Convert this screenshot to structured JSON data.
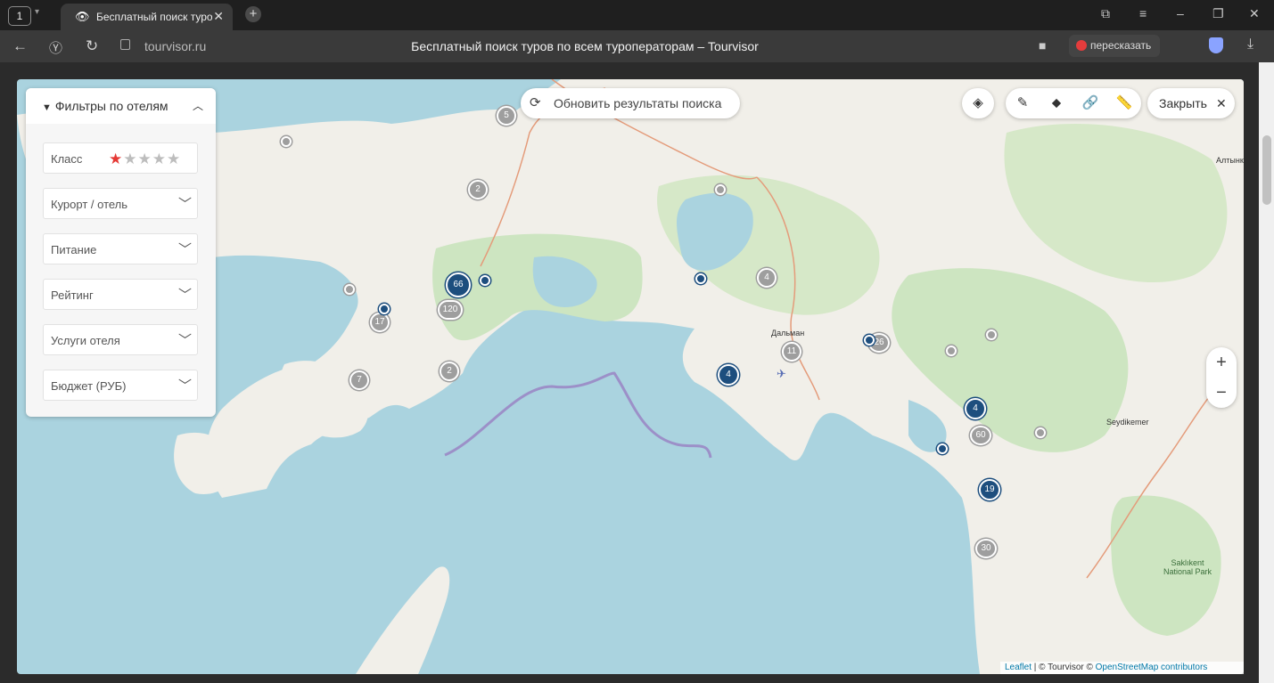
{
  "browser": {
    "tab_count": "1",
    "tab_title": "Бесплатный поиск туров",
    "domain": "tourvisor.ru",
    "page_title": "Бесплатный поиск туров по всем туроператорам – Tourvisor",
    "retell_label": "пересказать"
  },
  "filters": {
    "header": "Фильтры по отелям",
    "class_label": "Класс",
    "stars_filled": 1,
    "stars_total": 5,
    "rows": [
      "Курорт / отель",
      "Питание",
      "Рейтинг",
      "Услуги отеля",
      "Бюджет (РУБ)"
    ]
  },
  "map_controls": {
    "refresh_label": "Обновить результаты поиска",
    "close_label": "Закрыть",
    "zoom_in": "+",
    "zoom_out": "−"
  },
  "attribution": {
    "leaflet": "Leaflet",
    "sep1": " | © Tourvisor © ",
    "osm": "OpenStreetMap contributors"
  },
  "map_labels": [
    "Алтынк",
    "Дальман",
    "Seydikemer",
    "Saklıkent National Park"
  ],
  "markers": [
    {
      "label": "5",
      "color": "grey"
    },
    {
      "label": "2",
      "color": "grey"
    },
    {
      "label": "66",
      "color": "blue"
    },
    {
      "label": "120",
      "color": "grey"
    },
    {
      "label": "17",
      "color": "grey"
    },
    {
      "label": "2",
      "color": "grey"
    },
    {
      "label": "7",
      "color": "grey"
    },
    {
      "label": "4",
      "color": "grey"
    },
    {
      "label": "11",
      "color": "grey"
    },
    {
      "label": "4",
      "color": "blue"
    },
    {
      "label": "26",
      "color": "grey"
    },
    {
      "label": "4",
      "color": "blue"
    },
    {
      "label": "60",
      "color": "grey"
    },
    {
      "label": "19",
      "color": "blue"
    },
    {
      "label": "30",
      "color": "grey"
    }
  ]
}
